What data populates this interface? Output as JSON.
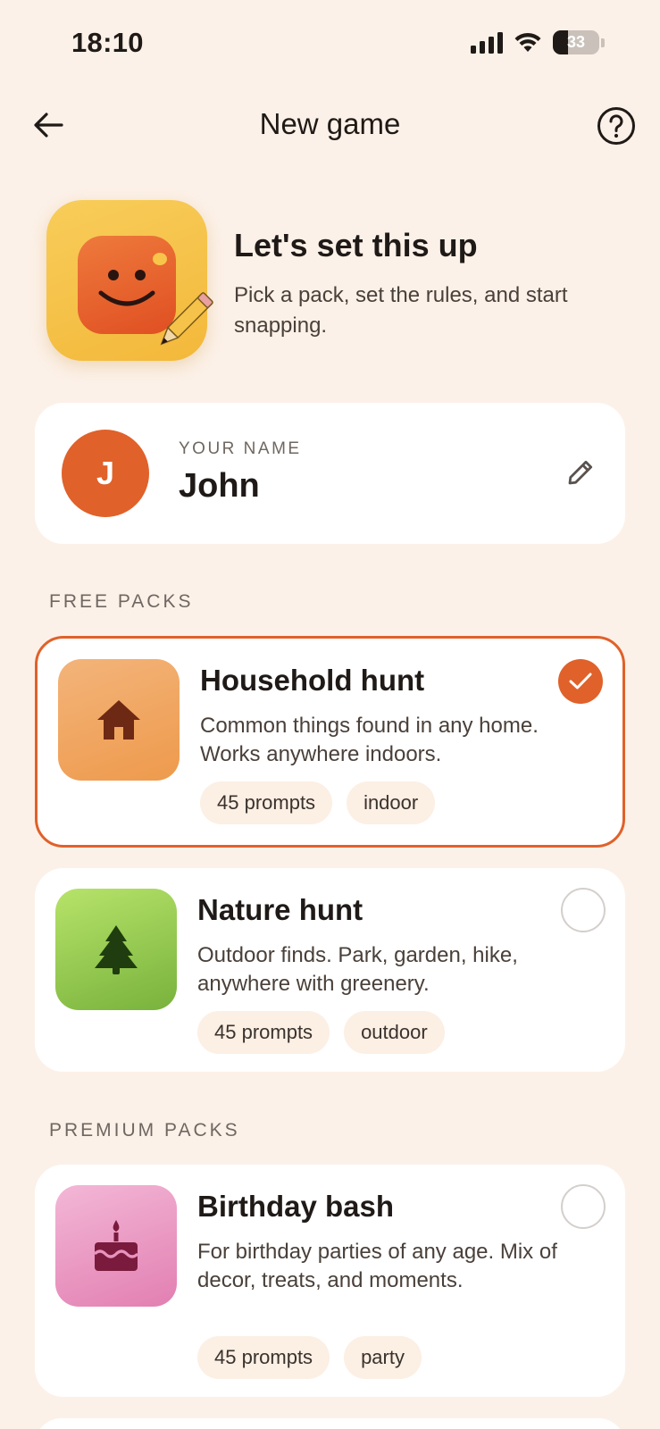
{
  "status_bar": {
    "time": "18:10",
    "battery": "33",
    "battery_level": 0.33
  },
  "header": {
    "title": "New game"
  },
  "hero": {
    "title": "Let's set this up",
    "subtitle": "Pick a pack, set the rules, and start snapping."
  },
  "player": {
    "avatar_initial": "J",
    "label": "YOUR NAME",
    "name": "John"
  },
  "sections": {
    "free": "FREE PACKS",
    "premium": "PREMIUM PACKS"
  },
  "packs": [
    {
      "title": "Household hunt",
      "description": "Common things found in any home. Works anywhere indoors.",
      "tags": [
        "45 prompts",
        "indoor"
      ],
      "icon": "house-icon",
      "selected": true
    },
    {
      "title": "Nature hunt",
      "description": "Outdoor finds. Park, garden, hike, anywhere with greenery.",
      "tags": [
        "45 prompts",
        "outdoor"
      ],
      "icon": "tree-icon",
      "selected": false
    },
    {
      "title": "Birthday bash",
      "description": "For birthday parties of any age. Mix of decor, treats, and moments.",
      "tags": [
        "45 prompts",
        "party"
      ],
      "icon": "cake-icon",
      "selected": false
    }
  ],
  "colors": {
    "background": "#fcf1e8",
    "accent": "#e0612a",
    "card": "#ffffff",
    "tag": "#fcefe4"
  }
}
